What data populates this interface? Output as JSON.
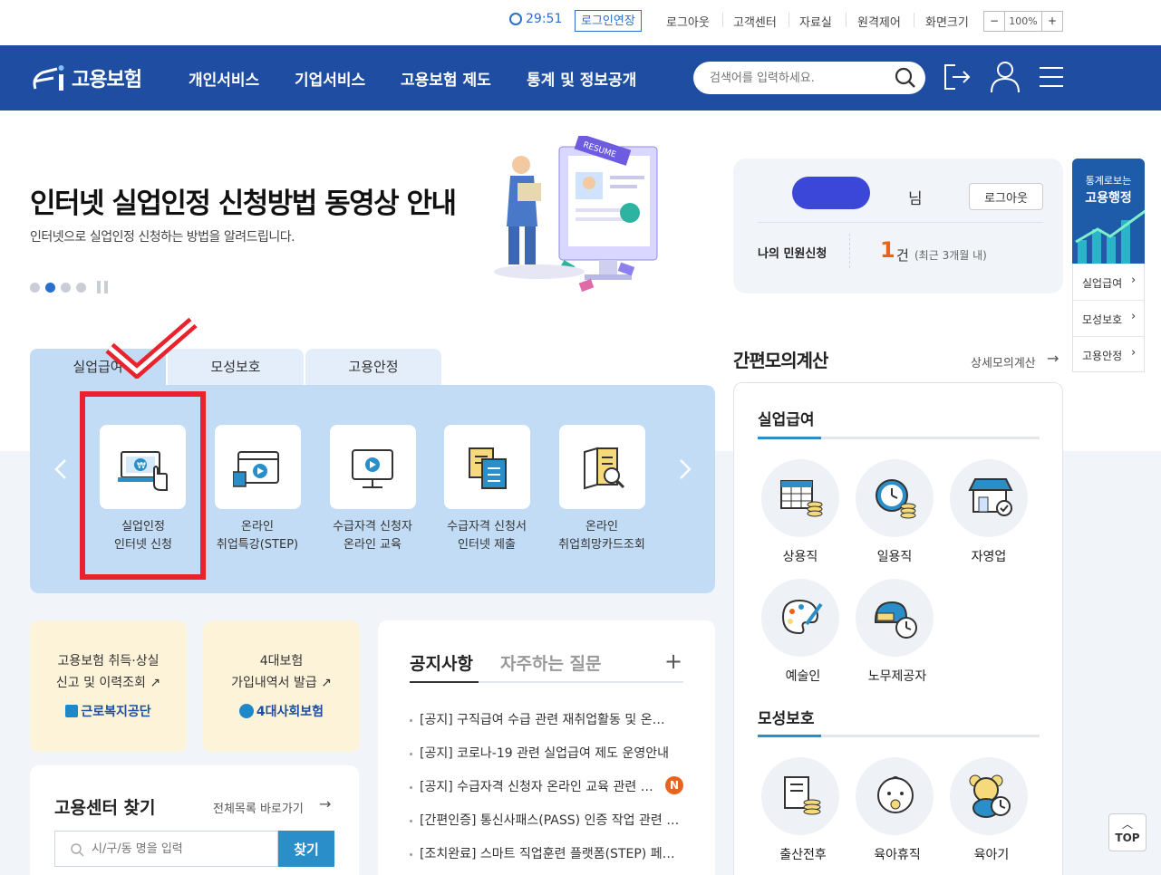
{
  "utility_bar": {
    "timer": "29:51",
    "extend_login": "로그인연장",
    "logout": "로그아웃",
    "customer_center": "고객센터",
    "resources": "자료실",
    "remote": "원격제어",
    "screen_size": "화면크기",
    "zoom_minus": "−",
    "zoom_value": "100%",
    "zoom_plus": "+"
  },
  "header": {
    "logo_text": "고용보험",
    "nav": [
      "개인서비스",
      "기업서비스",
      "고용보험 제도",
      "통계 및 정보공개"
    ],
    "search_placeholder": "검색어를 입력하세요."
  },
  "hero": {
    "title": "인터넷 실업인정 신청방법 동영상 안내",
    "subtitle": "인터넷으로 실업인정 신청하는 방법을 알려드립니다.",
    "resume_label": "RESUME"
  },
  "tabs": [
    "실업급여",
    "모성보호",
    "고용안정"
  ],
  "services": [
    {
      "line1": "실업인정",
      "line2": "인터넷 신청"
    },
    {
      "line1": "온라인",
      "line2": "취업특강(STEP)"
    },
    {
      "line1": "수급자격 신청자",
      "line2": "온라인 교육"
    },
    {
      "line1": "수급자격 신청서",
      "line2": "인터넷 제출"
    },
    {
      "line1": "온라인",
      "line2": "취업희망카드조회"
    }
  ],
  "user": {
    "suffix": "님",
    "logout": "로그아웃",
    "my_request_label": "나의 민원신청",
    "count": "1",
    "count_unit": "건",
    "count_note": "(최근 3개월 내)"
  },
  "stats_side": {
    "title_small": "통계로보는",
    "title_big": "고용행정",
    "links": [
      "실업급여",
      "모성보호",
      "고용안정"
    ]
  },
  "calc": {
    "title": "간편모의계산",
    "detail_link": "상세모의계산",
    "section1": "실업급여",
    "items1": [
      "상용직",
      "일용직",
      "자영업",
      "예술인",
      "노무제공자"
    ],
    "section2": "모성보호",
    "items2": [
      "출산전후",
      "육아휴직",
      "육아기"
    ]
  },
  "cards": [
    {
      "line1": "고용보험 취득·상실",
      "line2": "신고 및 이력조회",
      "brand": "근로복지공단"
    },
    {
      "line1": "4대보험",
      "line2": "가입내역서 발급",
      "brand": "4대사회보험"
    }
  ],
  "notice": {
    "tab_active": "공지사항",
    "tab_inactive": "자주하는 질문",
    "more": "+",
    "items": [
      "[공지] 구직급여 수급 관련 재취업활동 및 온라인 교육 관련",
      "[공지] 코로나-19 관련 실업급여 제도 운영안내",
      "[공지] 수급자격 신청자 온라인 교육 관련 안내",
      "[간편인증] 통신사패스(PASS) 인증 작업 관련 안내",
      "[조치완료] 스마트 직업훈련 플랫폼(STEP) 페이지 오류"
    ],
    "new_badge": "N"
  },
  "center_find": {
    "title": "고용센터 찾기",
    "all_link": "전체목록 바로가기",
    "placeholder": "시/구/동 명을 입력",
    "button": "찾기"
  },
  "top_button": "TOP",
  "colors": {
    "header_bg": "#1e4da1",
    "accent": "#2a6fc9",
    "panel_bg": "#c2dcf6",
    "annotation_red": "#e8232d"
  }
}
